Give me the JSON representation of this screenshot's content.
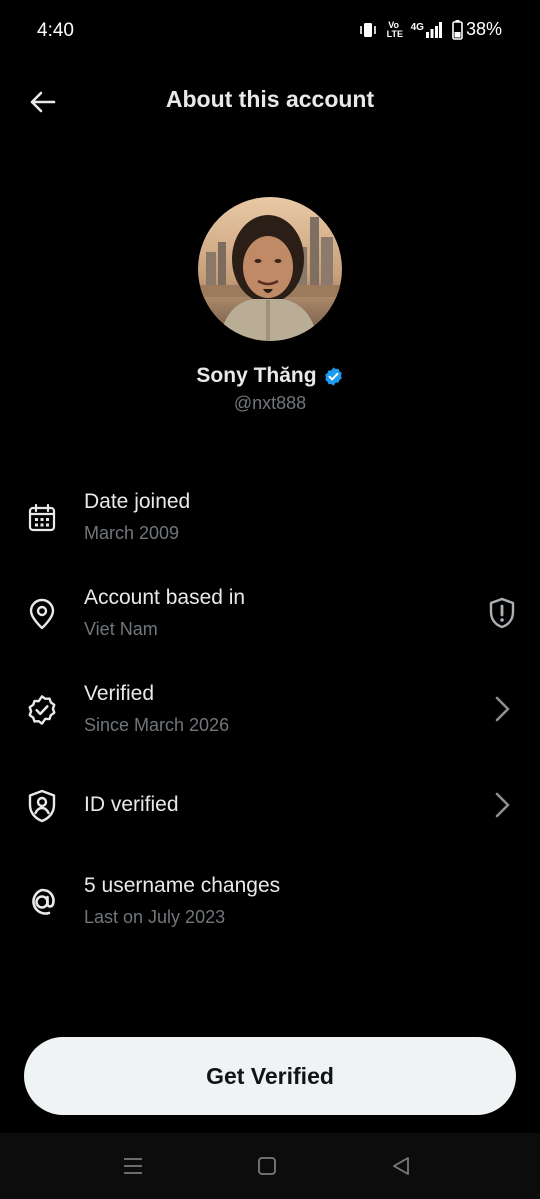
{
  "status": {
    "time": "4:40",
    "volte_label": "Vo LTE",
    "network": "4G",
    "battery": "38%"
  },
  "header": {
    "title": "About this account"
  },
  "profile": {
    "display_name": "Sony Thăng",
    "handle": "@nxt888",
    "verified_color": "#1d9bf0"
  },
  "rows": [
    {
      "icon": "calendar-icon",
      "title": "Date joined",
      "subtitle": "March 2009"
    },
    {
      "icon": "location-pin-icon",
      "title": "Account based in",
      "subtitle": "Viet Nam",
      "trailing": "shield-alert-icon"
    },
    {
      "icon": "verified-badge-icon",
      "title": "Verified",
      "subtitle": "Since March 2026",
      "trailing": "chevron-right-icon"
    },
    {
      "icon": "id-shield-icon",
      "title": "ID verified",
      "trailing": "chevron-right-icon"
    },
    {
      "icon": "at-sign-icon",
      "title": "5 username changes",
      "subtitle": "Last on July 2023"
    }
  ],
  "cta": {
    "label": "Get Verified"
  }
}
